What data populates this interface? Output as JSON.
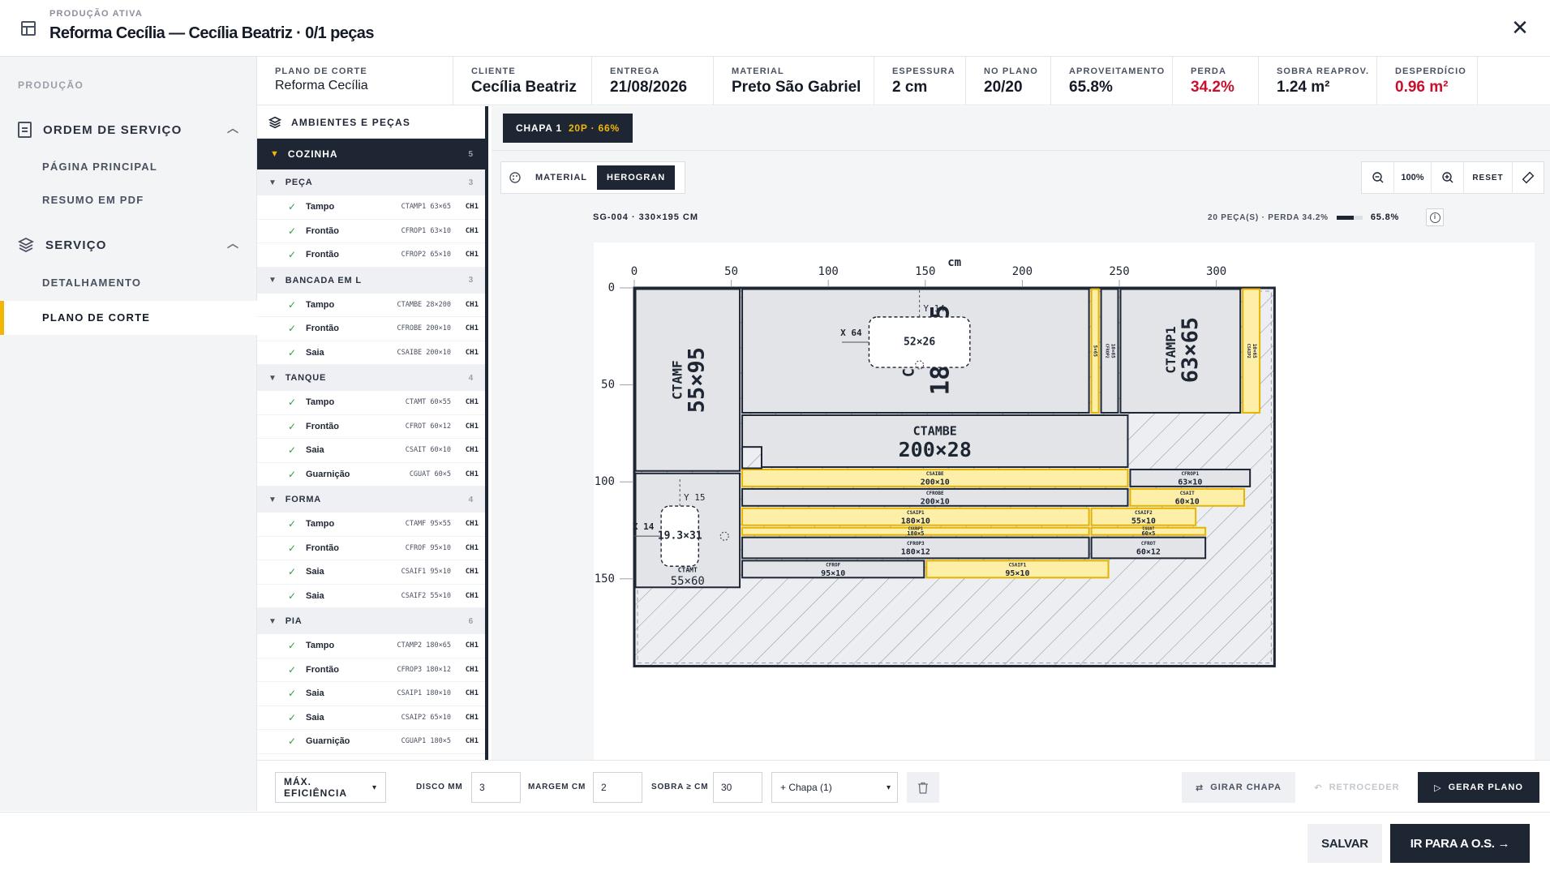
{
  "topbar": {
    "eyebrow": "PRODUÇÃO ATIVA",
    "title": "Reforma Cecília — Cecília Beatriz · 0/1 peças",
    "close": "✕"
  },
  "sidebar": {
    "section": "PRODUÇÃO",
    "group1": "ORDEM DE SERVIÇO",
    "group1_items": [
      "PÁGINA PRINCIPAL",
      "RESUMO EM PDF"
    ],
    "group2": "SERVIÇO",
    "group2_items": [
      "DETALHAMENTO",
      "PLANO DE CORTE"
    ]
  },
  "info": [
    {
      "label": "PLANO DE CORTE",
      "value": "Reforma Cecília"
    },
    {
      "label": "CLIENTE",
      "value": "Cecília Beatriz"
    },
    {
      "label": "ENTREGA",
      "value": "21/08/2026"
    },
    {
      "label": "MATERIAL",
      "value": "Preto São Gabriel"
    },
    {
      "label": "ESPESSURA",
      "value": "2 cm"
    },
    {
      "label": "NO PLANO",
      "value": "20/20"
    },
    {
      "label": "APROVEITAMENTO",
      "value": "65.8%"
    },
    {
      "label": "PERDA",
      "value": "34.2%"
    },
    {
      "label": "SOBRA REAPROV.",
      "value": "1.24 m²"
    },
    {
      "label": "DESPERDÍCIO",
      "value": "0.96 m²"
    }
  ],
  "pieces": {
    "title": "AMBIENTES E PEÇAS",
    "room": "COZINHA",
    "room_count": "5",
    "groups": [
      {
        "name": "PEÇA",
        "count": "3",
        "items": [
          {
            "name": "Tampo",
            "code": "CTAMP1 63×65",
            "ch": "CH1"
          },
          {
            "name": "Frontão",
            "code": "CFROP1 63×10",
            "ch": "CH1"
          },
          {
            "name": "Frontão",
            "code": "CFROP2 65×10",
            "ch": "CH1"
          }
        ]
      },
      {
        "name": "BANCADA EM L",
        "count": "3",
        "items": [
          {
            "name": "Tampo",
            "code": "CTAMBE 28×200",
            "ch": "CH1"
          },
          {
            "name": "Frontão",
            "code": "CFROBE 200×10",
            "ch": "CH1"
          },
          {
            "name": "Saia",
            "code": "CSAIBE 200×10",
            "ch": "CH1"
          }
        ]
      },
      {
        "name": "TANQUE",
        "count": "4",
        "items": [
          {
            "name": "Tampo",
            "code": "CTAMT 60×55",
            "ch": "CH1"
          },
          {
            "name": "Frontão",
            "code": "CFROT 60×12",
            "ch": "CH1"
          },
          {
            "name": "Saia",
            "code": "CSAIT 60×10",
            "ch": "CH1"
          },
          {
            "name": "Guarnição",
            "code": "CGUAT 60×5",
            "ch": "CH1"
          }
        ]
      },
      {
        "name": "FORMA",
        "count": "4",
        "items": [
          {
            "name": "Tampo",
            "code": "CTAMF 95×55",
            "ch": "CH1"
          },
          {
            "name": "Frontão",
            "code": "CFROF 95×10",
            "ch": "CH1"
          },
          {
            "name": "Saia",
            "code": "CSAIF1 95×10",
            "ch": "CH1"
          },
          {
            "name": "Saia",
            "code": "CSAIF2 55×10",
            "ch": "CH1"
          }
        ]
      },
      {
        "name": "PIA",
        "count": "6",
        "items": [
          {
            "name": "Tampo",
            "code": "CTAMP2 180×65",
            "ch": "CH1"
          },
          {
            "name": "Frontão",
            "code": "CFROP3 180×12",
            "ch": "CH1"
          },
          {
            "name": "Saia",
            "code": "CSAIP1 180×10",
            "ch": "CH1"
          },
          {
            "name": "Saia",
            "code": "CSAIP2 65×10",
            "ch": "CH1"
          },
          {
            "name": "Guarnição",
            "code": "CGUAP1 180×5",
            "ch": "CH1"
          }
        ]
      }
    ]
  },
  "canvas": {
    "chapa_label": "CHAPA 1",
    "chapa_sub": "20P · 66%",
    "modes": [
      "MATERIAL",
      "HEROGRAN"
    ],
    "active_mode": "HEROGRAN",
    "zoom": "100%",
    "reset": "RESET",
    "sheet": "SG-004 · 330×195 CM",
    "stats": "20 PEÇA(S) · PERDA 34.2%",
    "yield": "65.8%",
    "yield_fraction": 0.658,
    "unit": "cm",
    "x_ticks": [
      "0",
      "50",
      "100",
      "150",
      "200",
      "250",
      "300"
    ],
    "y_ticks": [
      "0",
      "50",
      "100",
      "150"
    ],
    "colors": {
      "piece": "#e2e4e8",
      "offcut": "#fdeea8",
      "offcut_border": "#e6b400",
      "dark": "#1e2533"
    }
  },
  "plan_pieces": [
    {
      "x": 0,
      "y": 0,
      "w": 55,
      "h": 95,
      "label": "CTAMF",
      "dims": "55×95",
      "style": "grey",
      "rot": true,
      "size": "big"
    },
    {
      "x": 55,
      "y": 0,
      "w": 180,
      "h": 65,
      "label": "CTAMP2",
      "dims": "180×65",
      "style": "grey",
      "rot": true,
      "size": "huge",
      "lx": 150,
      "ly": 32
    },
    {
      "x": 235,
      "y": 0,
      "w": 5,
      "h": 65,
      "label": "",
      "dims": "5×65",
      "style": "yellow",
      "rot": true,
      "size": "tiny"
    },
    {
      "x": 240,
      "y": 0,
      "w": 10,
      "h": 65,
      "label": "CFROP2",
      "dims": "10×65",
      "style": "grey",
      "rot": true,
      "size": "tiny"
    },
    {
      "x": 250,
      "y": 0,
      "w": 63,
      "h": 65,
      "label": "CTAMP1",
      "dims": "63×65",
      "style": "grey",
      "rot": true,
      "size": "big",
      "lx": 282,
      "ly": 32
    },
    {
      "x": 313,
      "y": 0,
      "w": 10,
      "h": 65,
      "label": "CSAIP2",
      "dims": "10×65",
      "style": "yellow",
      "rot": true,
      "size": "tiny"
    },
    {
      "x": 55,
      "y": 65,
      "w": 200,
      "h": 28,
      "label": "CTAMBE",
      "dims": "200×28",
      "style": "grey",
      "size": "mid"
    },
    {
      "x": 55,
      "y": 93,
      "w": 200,
      "h": 10,
      "label": "CSAIBE",
      "dims": "200×10",
      "style": "yellow",
      "size": "tiny"
    },
    {
      "x": 55,
      "y": 103,
      "w": 200,
      "h": 10,
      "label": "CFROBE",
      "dims": "200×10",
      "style": "grey",
      "size": "tiny"
    },
    {
      "x": 55,
      "y": 113,
      "w": 180,
      "h": 10,
      "label": "CSAIP1",
      "dims": "180×10",
      "style": "yellow",
      "size": "tiny"
    },
    {
      "x": 55,
      "y": 123,
      "w": 180,
      "h": 5,
      "label": "CGUAP1",
      "dims": "180×5",
      "style": "yellow",
      "size": "tiny"
    },
    {
      "x": 55,
      "y": 128,
      "w": 180,
      "h": 12,
      "label": "CFROP3",
      "dims": "180×12",
      "style": "grey",
      "size": "tiny"
    },
    {
      "x": 255,
      "y": 93,
      "w": 63,
      "h": 10,
      "label": "CFROP1",
      "dims": "63×10",
      "style": "grey",
      "size": "tiny"
    },
    {
      "x": 255,
      "y": 103,
      "w": 60,
      "h": 10,
      "label": "CSAIT",
      "dims": "60×10",
      "style": "yellow",
      "size": "tiny"
    },
    {
      "x": 235,
      "y": 113,
      "w": 55,
      "h": 10,
      "label": "CSAIF2",
      "dims": "55×10",
      "style": "yellow",
      "size": "tiny"
    },
    {
      "x": 235,
      "y": 123,
      "w": 60,
      "h": 5,
      "label": "CGUAT",
      "dims": "60×5",
      "style": "yellow",
      "size": "tiny"
    },
    {
      "x": 235,
      "y": 128,
      "w": 60,
      "h": 12,
      "label": "CFROT",
      "dims": "60×12",
      "style": "grey",
      "size": "tiny"
    },
    {
      "x": 55,
      "y": 140,
      "w": 95,
      "h": 10,
      "label": "CFROF",
      "dims": "95×10",
      "style": "grey",
      "size": "tiny"
    },
    {
      "x": 150,
      "y": 140,
      "w": 95,
      "h": 10,
      "label": "CSAIF1",
      "dims": "95×10",
      "style": "yellow",
      "size": "tiny"
    },
    {
      "x": 0,
      "y": 95,
      "w": 55,
      "h": 60,
      "label": "CTAMT",
      "dims": "55×60",
      "style": "grey",
      "size": "small",
      "ly": 148
    }
  ],
  "plan_cutouts": [
    {
      "cx": 147,
      "cy": 28,
      "w": 52,
      "h": 26,
      "label": "52×26",
      "xoff": "X 64",
      "yoff": "Y 14"
    },
    {
      "cx": 23.5,
      "cy": 128,
      "w": 19.3,
      "h": 31,
      "label": "19.3×31",
      "xoff": "X 14",
      "yoff": "Y 15"
    }
  ],
  "toolbar": {
    "strategy": "MÁX. EFICIÊNCIA",
    "disco_label": "DISCO MM",
    "disco": "3",
    "margem_label": "MARGEM CM",
    "margem": "2",
    "sobra_label": "SOBRA ≥ CM",
    "sobra": "30",
    "chapa_select": "+ Chapa (1)",
    "girar": "GIRAR CHAPA",
    "retroceder": "RETROCEDER",
    "gerar": "GERAR PLANO"
  },
  "footer": {
    "salvar": "SALVAR",
    "ir": "IR PARA A O.S. →"
  }
}
